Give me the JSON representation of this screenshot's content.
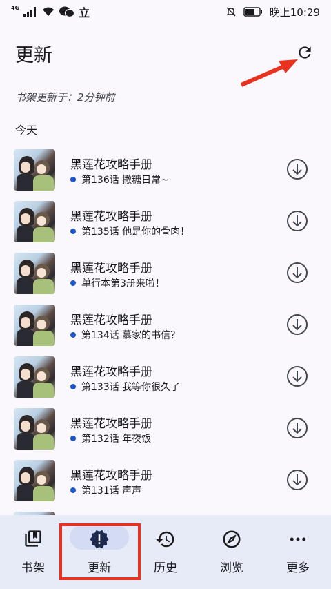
{
  "status_bar": {
    "network": "4G",
    "app_icon_text": "立",
    "time": "晚上10:29"
  },
  "header": {
    "title": "更新",
    "refresh_icon": "refresh-icon"
  },
  "update_info": "书架更新于：2分钟前",
  "section_title": "今天",
  "items": [
    {
      "title": "黑莲花攻略手册",
      "chapter": "第136话 撒糖日常~"
    },
    {
      "title": "黑莲花攻略手册",
      "chapter": "第135话 他是你的骨肉！"
    },
    {
      "title": "黑莲花攻略手册",
      "chapter": "单行本第3册来啦！"
    },
    {
      "title": "黑莲花攻略手册",
      "chapter": "第134话 慕家的书信？"
    },
    {
      "title": "黑莲花攻略手册",
      "chapter": "第133话 我等你很久了"
    },
    {
      "title": "黑莲花攻略手册",
      "chapter": "第132话 年夜饭"
    },
    {
      "title": "黑莲花攻略手册",
      "chapter": "第131话 声声"
    }
  ],
  "bottom_nav": [
    {
      "label": "书架",
      "icon": "bookshelf-icon"
    },
    {
      "label": "更新",
      "icon": "new-releases-icon",
      "active": true
    },
    {
      "label": "历史",
      "icon": "history-icon"
    },
    {
      "label": "浏览",
      "icon": "compass-icon"
    },
    {
      "label": "更多",
      "icon": "more-horiz-icon"
    }
  ],
  "colors": {
    "background": "#fbf8fd",
    "nav_background": "#e7ebf7",
    "active_pill": "#d4dcf4",
    "unread_dot": "#1e56c8",
    "annotation_red": "#e8321f"
  }
}
